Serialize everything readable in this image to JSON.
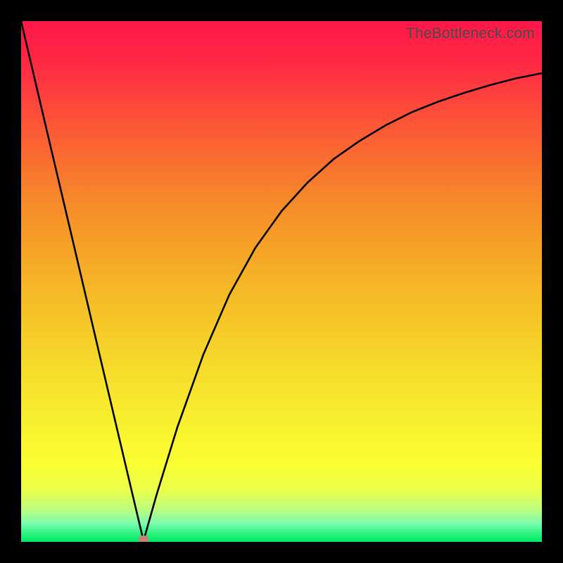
{
  "watermark": "TheBottleneck.com",
  "colors": {
    "black": "#000000",
    "curve": "#000000",
    "marker": "#c97e76",
    "gradient_stops": [
      {
        "offset": 0.0,
        "color": "#ff1749"
      },
      {
        "offset": 0.08,
        "color": "#ff2944"
      },
      {
        "offset": 0.2,
        "color": "#fb5736"
      },
      {
        "offset": 0.35,
        "color": "#f68b29"
      },
      {
        "offset": 0.5,
        "color": "#f5b427"
      },
      {
        "offset": 0.65,
        "color": "#f6d82a"
      },
      {
        "offset": 0.78,
        "color": "#f8f22f"
      },
      {
        "offset": 0.85,
        "color": "#faff33"
      },
      {
        "offset": 0.9,
        "color": "#ecff4b"
      },
      {
        "offset": 0.94,
        "color": "#b7fe82"
      },
      {
        "offset": 0.965,
        "color": "#7bfbaf"
      },
      {
        "offset": 0.985,
        "color": "#2af27e"
      },
      {
        "offset": 1.0,
        "color": "#00e765"
      }
    ]
  },
  "chart_data": {
    "type": "line",
    "title": "",
    "xlabel": "",
    "ylabel": "",
    "xlim": [
      0,
      100
    ],
    "ylim": [
      0,
      100
    ],
    "grid": false,
    "legend": false,
    "series": [
      {
        "name": "bottleneck-curve",
        "segment": "left",
        "x": [
          0,
          5,
          10,
          15,
          20,
          23.5
        ],
        "y": [
          100,
          78.7,
          57.5,
          36.2,
          15.0,
          0.2
        ]
      },
      {
        "name": "bottleneck-curve",
        "segment": "right",
        "x": [
          23.5,
          26,
          30,
          35,
          40,
          45,
          50,
          55,
          60,
          65,
          70,
          75,
          80,
          85,
          90,
          95,
          100
        ],
        "y": [
          0.2,
          9.0,
          22.0,
          36.0,
          47.5,
          56.5,
          63.5,
          69.0,
          73.5,
          77.0,
          80.0,
          82.5,
          84.5,
          86.2,
          87.7,
          89.0,
          90.0
        ]
      }
    ],
    "marker": {
      "x": 23.5,
      "y": 0.6
    }
  }
}
